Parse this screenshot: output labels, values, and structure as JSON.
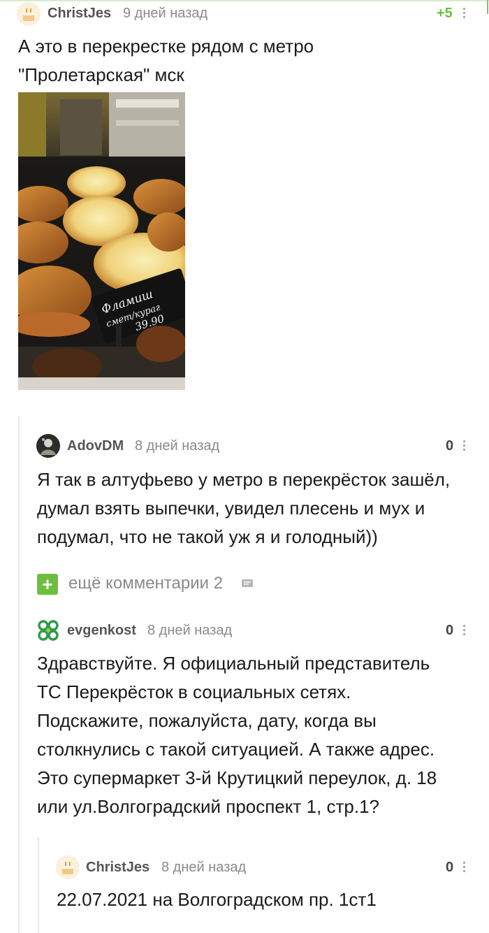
{
  "comments": [
    {
      "nick": "ChristJes",
      "time": "9 дней назад",
      "rating": "+5",
      "text_lines": [
        "А это в перекрестке рядом с метро",
        "\"Пролетарская\" мск"
      ],
      "image_label": "Фламиш сметана/курага 39.90"
    },
    {
      "nick": "AdovDM",
      "time": "8 дней назад",
      "rating": "0",
      "text_lines": [
        "Я так в алтуфьево у метро в перекрёсток зашёл,",
        "думал взять выпечки, увидел плесень и мух и",
        "подумал, что не такой уж я и голодный))"
      ]
    },
    {
      "nick": "evgenkost",
      "time": "8 дней назад",
      "rating": "0",
      "text_lines": [
        "Здравствуйте. Я официальный представитель",
        "ТС Перекрёсток в социальных сетях.",
        "Подскажите, пожалуйста, дату, когда вы",
        "столкнулись с такой ситуацией. А также адрес.",
        "Это супермаркет 3-й Крутицкий переулок, д. 18",
        "или ул.Волгоградский проспект 1, стр.1?"
      ]
    },
    {
      "nick": "ChristJes",
      "time": "8 дней назад",
      "rating": "0",
      "text_lines": [
        "22.07.2021 на Волгоградском пр. 1ст1"
      ]
    }
  ],
  "more_comments": {
    "plus": "+",
    "label": "ещё комментарии 2"
  },
  "colors": {
    "accent_green": "#6cbf3c",
    "nick": "#555555",
    "time": "#8a8a8a"
  }
}
